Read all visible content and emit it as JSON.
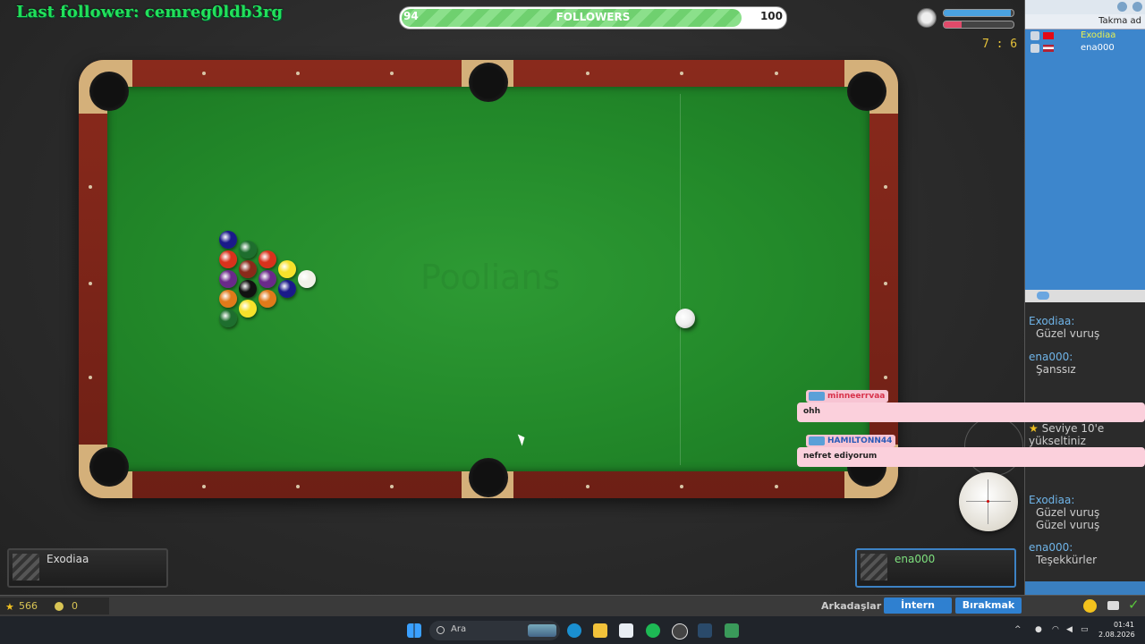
{
  "overlay": {
    "last_follower": "Last follower: cemreg0ldb3rg",
    "followers_goal": {
      "label": "FOLLOWERS",
      "current": "94",
      "target": "100",
      "progress": 0.94
    },
    "chat_messages": [
      {
        "user": "minneerrvaa",
        "text": "ohh"
      },
      {
        "user": "HAMILTONN44",
        "text": "nefret ediyorum"
      }
    ]
  },
  "game": {
    "watermark": "Poolians",
    "score": "7 : 6",
    "timer_colors": {
      "player1": "#4aa2e0",
      "player2": "#e04a6a"
    },
    "players": [
      {
        "name": "Exodiaa",
        "active": false
      },
      {
        "name": "ena000",
        "active": true
      }
    ],
    "ball_colors": [
      "#f1f1e8",
      "#f7e12b",
      "#1a1a8a",
      "#d8321c",
      "#6a2a8a",
      "#e07a1a",
      "#1e6e2e",
      "#8a2a1a",
      "#111111",
      "#f7e12b",
      "#1a1a8a",
      "#d8321c",
      "#6a2a8a",
      "#e07a1a",
      "#1e6e2e"
    ]
  },
  "sidebar": {
    "column_header": "Takma ad",
    "users": [
      {
        "name": "Exodiaa",
        "flag": "tr"
      },
      {
        "name": "ena000",
        "flag": "us"
      }
    ],
    "chat": [
      {
        "who": "Exodiaa:",
        "msgs": [
          "Güzel vuruş"
        ]
      },
      {
        "who": "ena000:",
        "msgs": [
          "Şanssız"
        ]
      },
      {
        "system": "Seviye 10'e yükseltiniz"
      },
      {
        "who": "Exodiaa:",
        "msgs": [
          "Güzel vuruş",
          "Güzel vuruş"
        ]
      },
      {
        "who": "ena000:",
        "msgs": [
          "Teşekkürler"
        ]
      }
    ]
  },
  "bottombar": {
    "stars": "566",
    "coins": "0",
    "friends_label": "Arkadaşlar",
    "btn_intern": "İntern",
    "btn_leave": "Bırakmak"
  },
  "taskbar": {
    "search_placeholder": "Ara",
    "time": "01:41",
    "date": "2.08.2026"
  }
}
